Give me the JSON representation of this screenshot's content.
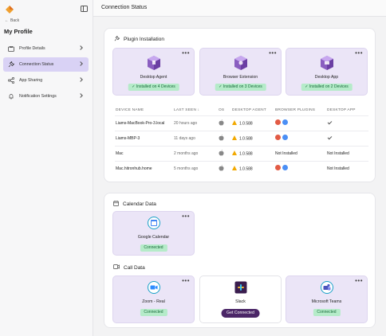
{
  "sidebar": {
    "back_label": "Back",
    "profile_title": "My Profile",
    "items": [
      {
        "label": "Profile Details",
        "icon": "id-card-icon"
      },
      {
        "label": "Connection Status",
        "icon": "plug-icon",
        "active": true
      },
      {
        "label": "App Sharing",
        "icon": "share-icon"
      },
      {
        "label": "Notification Settings",
        "icon": "bell-icon"
      }
    ]
  },
  "header": {
    "title": "Connection Status"
  },
  "plugin": {
    "title": "Plugin Installation",
    "tiles": [
      {
        "name": "Desktop Agent",
        "status": "Installed on 4 Devices"
      },
      {
        "name": "Browser Extension",
        "status": "Installed on 3 Devices"
      },
      {
        "name": "Desktop App",
        "status": "Installed on 2 Devices"
      }
    ],
    "table": {
      "headers": [
        "DEVICE NAME",
        "LAST SEEN",
        "OS",
        "DESKTOP AGENT",
        "BROWSER PLUGINS",
        "DESKTOP APP"
      ],
      "sort_indicator": "↓",
      "rows": [
        {
          "device": "Liams-MacBook-Pro-3.local",
          "last_seen": "20 hours ago",
          "agent": "1.0.588",
          "plugins": "icons",
          "app": "check"
        },
        {
          "device": "Liams-MBP-3",
          "last_seen": "11 days ago",
          "agent": "1.0.588",
          "plugins": "icons",
          "app": "check"
        },
        {
          "device": "Mac",
          "last_seen": "2 months ago",
          "agent": "1.0.588",
          "plugins": "Not Installed",
          "app": "Not Installed"
        },
        {
          "device": "Mac.hitronhub.home",
          "last_seen": "5 months ago",
          "agent": "1.0.588",
          "plugins": "icons",
          "app": "Not Installed"
        }
      ]
    }
  },
  "calendar": {
    "title": "Calendar Data",
    "tiles": [
      {
        "name": "Google Calendar",
        "status": "Connected"
      }
    ]
  },
  "call": {
    "title": "Call Data",
    "tiles": [
      {
        "name": "Zoom - Real",
        "status": "Connected"
      },
      {
        "name": "Slack",
        "action": "Get Connected"
      },
      {
        "name": "Microsoft Teams",
        "status": "Connected"
      }
    ]
  },
  "menu_glyph": "•••",
  "colors": {
    "accent": "#d9d2f5",
    "tile": "#ebe5f7",
    "connected_bg": "#b5ebc9",
    "connected_text": "#176a3a",
    "primary_button": "#4b2667",
    "warning": "#f2a900"
  }
}
